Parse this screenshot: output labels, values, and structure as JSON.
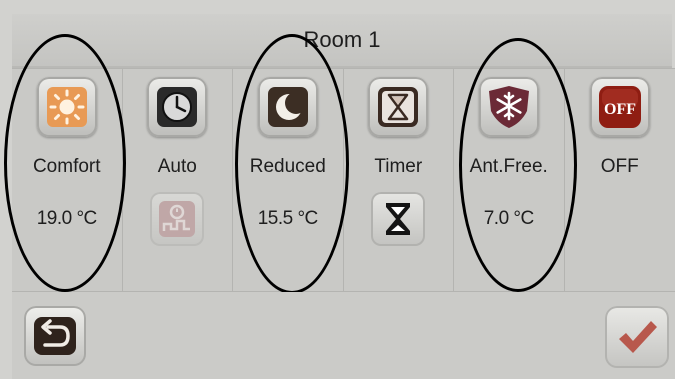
{
  "header": {
    "title": "Room 1"
  },
  "modes": [
    {
      "label": "Comfort",
      "temperature": "19.0 °C",
      "icon": "sun-icon",
      "sub_icon": "none"
    },
    {
      "label": "Auto",
      "temperature": "",
      "icon": "clock-icon",
      "sub_icon": "schedule-icon"
    },
    {
      "label": "Reduced",
      "temperature": "15.5 °C",
      "icon": "moon-icon",
      "sub_icon": "none"
    },
    {
      "label": "Timer",
      "temperature": "",
      "icon": "hourglass-icon",
      "sub_icon": "hourglass-icon"
    },
    {
      "label": "Ant.Free.",
      "temperature": "7.0 °C",
      "icon": "snowflake-icon",
      "sub_icon": "none"
    },
    {
      "label": "OFF",
      "temperature": "",
      "icon": "off-icon",
      "sub_icon": "none"
    }
  ],
  "icons": {
    "off_text": "OFF"
  },
  "footer": {
    "back_icon": "back-arrow-icon",
    "confirm_icon": "checkmark-icon"
  },
  "colors": {
    "panel": "#d2d2cf",
    "sun_orange": "#e89a55",
    "moon_dark": "#3c2e24",
    "snowflake_maroon": "#6b2a36",
    "off_red": "#8f1d12",
    "check_red": "#b8584c"
  }
}
